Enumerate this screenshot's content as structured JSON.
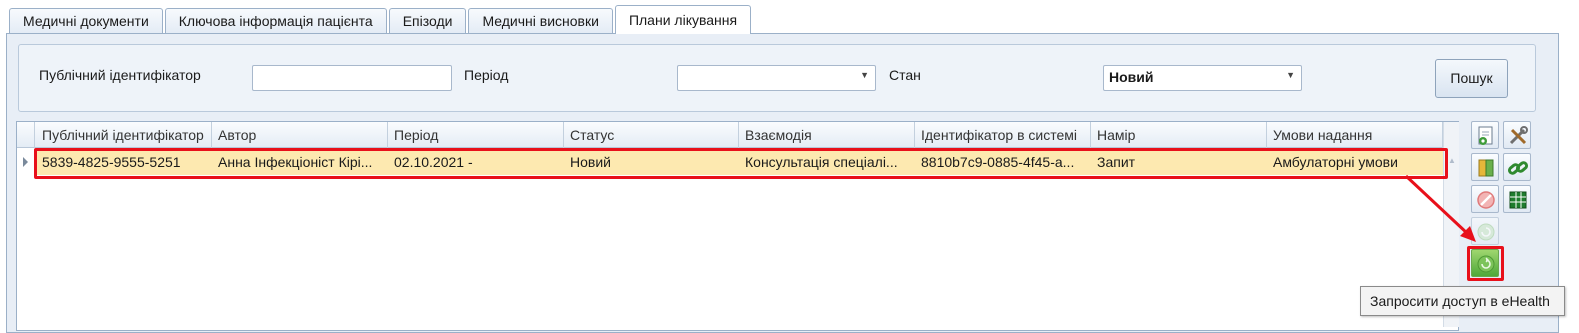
{
  "tabs": [
    {
      "label": "Медичні документи"
    },
    {
      "label": "Ключова інформація пацієнта"
    },
    {
      "label": "Епізоди"
    },
    {
      "label": "Медичні висновки"
    },
    {
      "label": "Плани лікування"
    }
  ],
  "active_tab": "Плани лікування",
  "filters": {
    "public_id_label": "Публічний ідентифікатор",
    "public_id_value": "",
    "period_label": "Період",
    "period_value": "",
    "state_label": "Стан",
    "state_value": "Новий",
    "search_button": "Пошук"
  },
  "grid": {
    "columns": [
      "Публічний ідентифікатор",
      "Автор",
      "Період",
      "Статус",
      "Взаємодія",
      "Ідентифікатор в системі",
      "Намір",
      "Умови надання"
    ],
    "rows": [
      [
        "5839-4825-9555-5251",
        "Анна Інфекціоніст Кірі...",
        "02.10.2021 -",
        "Новий",
        "Консультація спеціалі...",
        "8810b7c9-0885-4f45-a...",
        "Запит",
        "Амбулаторні умови"
      ]
    ]
  },
  "side_toolbar": {
    "icons": [
      "view-document-icon",
      "tools-icon",
      "book-icon",
      "link-icon",
      "cancel-icon",
      "grid-report-icon",
      "refresh-disabled-icon",
      "request-access-icon"
    ]
  },
  "tooltip": "Запросити доступ в eHealth",
  "colors": {
    "highlight": "#e8101a",
    "selected_row": "#fde9b0",
    "panel": "#e8eef6"
  }
}
